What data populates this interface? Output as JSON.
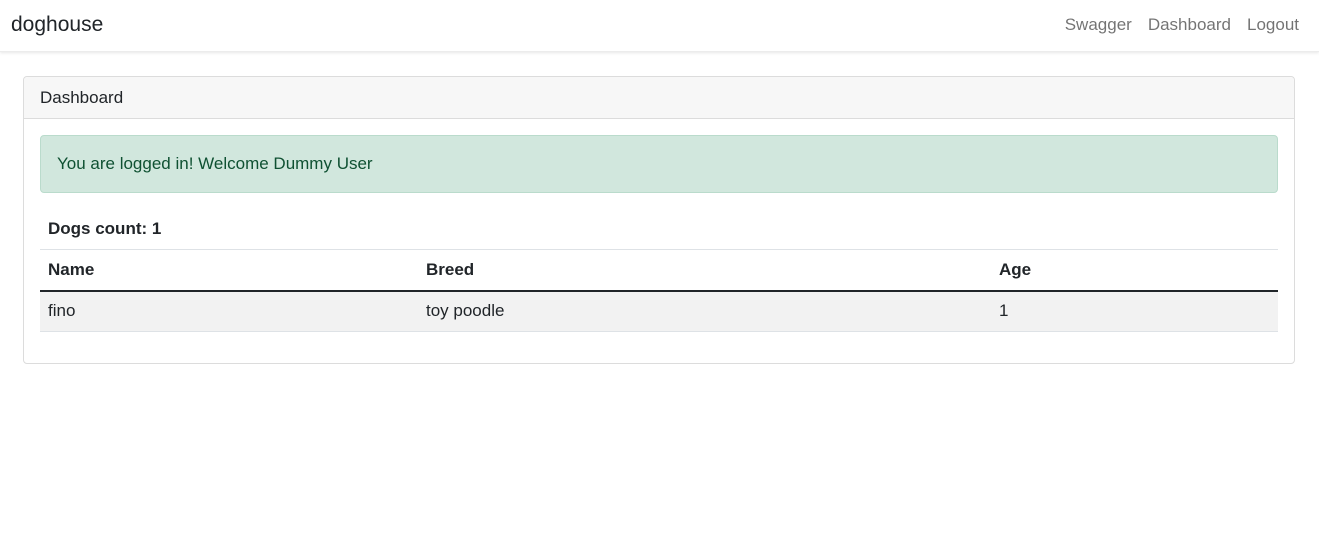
{
  "navbar": {
    "brand": "doghouse",
    "links": [
      "Swagger",
      "Dashboard",
      "Logout"
    ]
  },
  "card": {
    "header": "Dashboard",
    "alert": "You are logged in! Welcome Dummy User",
    "count_label": "Dogs count: 1"
  },
  "table": {
    "headers": [
      "Name",
      "Breed",
      "Age"
    ],
    "rows": [
      [
        "fino",
        "toy poodle",
        "1"
      ]
    ]
  },
  "colors": {
    "alert_bg": "#d1e7dd",
    "alert_text": "#0f5132",
    "row_stripe": "#f2f2f2"
  }
}
